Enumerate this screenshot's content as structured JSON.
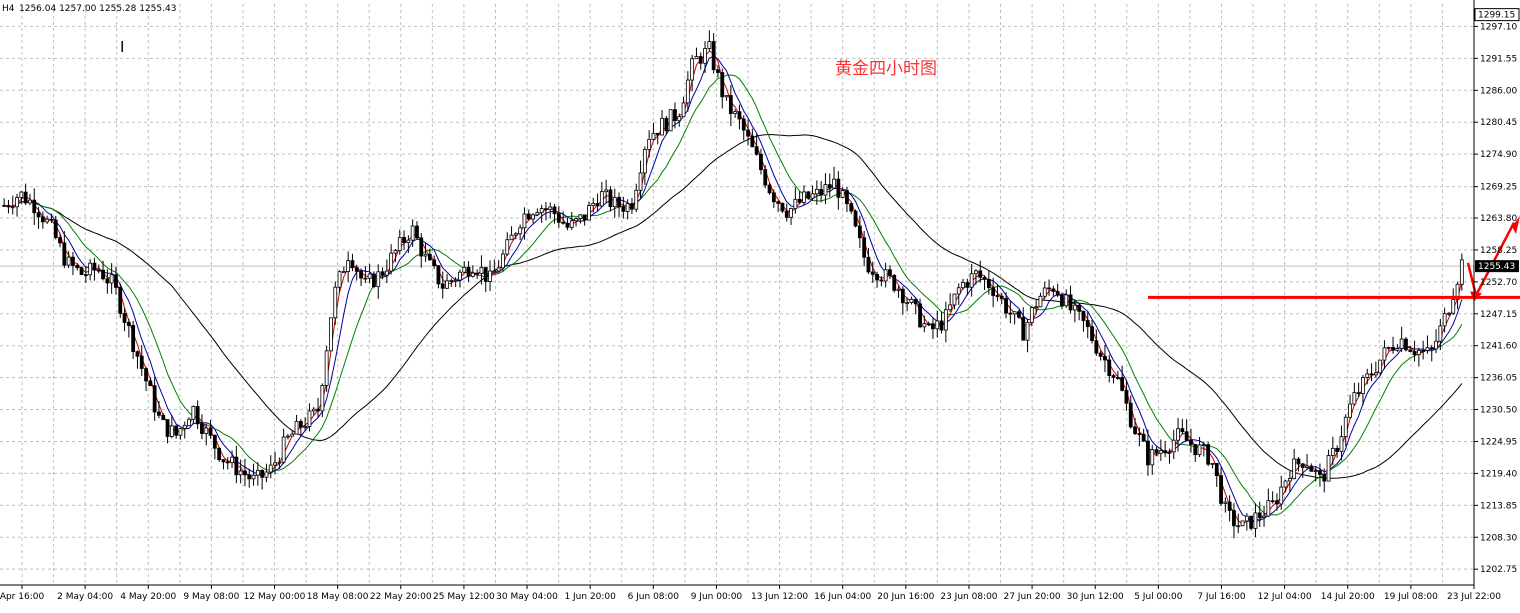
{
  "header": {
    "symbol_tf": "H4",
    "ohlc": "1256.04 1257.00 1255.28 1255.43",
    "marker": "I"
  },
  "chart_data": {
    "type": "candlestick",
    "title": "黄金四小时图",
    "timeframe": "H4",
    "ylim": [
      1200.0,
      1301.0
    ],
    "current_price": 1255.43,
    "top_price": 1299.15,
    "y_ticks": [
      "1297.10",
      "1291.55",
      "1286.00",
      "1280.45",
      "1274.90",
      "1269.25",
      "1263.80",
      "1258.25",
      "1252.70",
      "1247.15",
      "1241.60",
      "1236.05",
      "1230.50",
      "1224.95",
      "1219.40",
      "1213.85",
      "1208.30",
      "1202.75"
    ],
    "x_ticks": [
      "Apr 16:00",
      "2 May 04:00",
      "4 May 20:00",
      "9 May 08:00",
      "12 May 00:00",
      "18 May 08:00",
      "22 May 20:00",
      "25 May 12:00",
      "30 May 04:00",
      "1 Jun 20:00",
      "6 Jun 08:00",
      "9 Jun 00:00",
      "13 Jun 12:00",
      "16 Jun 04:00",
      "20 Jun 16:00",
      "23 Jun 08:00",
      "27 Jun 20:00",
      "30 Jun 12:00",
      "5 Jul 00:00",
      "7 Jul 16:00",
      "12 Jul 04:00",
      "14 Jul 20:00",
      "19 Jul 08:00",
      "23 Jul 22:00"
    ],
    "price_anchors": [
      1266,
      1268,
      1266,
      1262,
      1256,
      1254,
      1255,
      1252,
      1244,
      1236,
      1228,
      1226,
      1231,
      1226,
      1222,
      1220,
      1218,
      1220,
      1225,
      1228,
      1230,
      1250,
      1258,
      1252,
      1254,
      1258,
      1262,
      1256,
      1252,
      1254,
      1256,
      1253,
      1258,
      1264,
      1266,
      1265,
      1262,
      1264,
      1268,
      1266,
      1266,
      1278,
      1280,
      1282,
      1291,
      1293,
      1284,
      1280,
      1274,
      1268,
      1265,
      1267,
      1268,
      1270,
      1264,
      1256,
      1254,
      1252,
      1248,
      1244,
      1246,
      1252,
      1254,
      1252,
      1248,
      1244,
      1250,
      1252,
      1248,
      1245,
      1240,
      1236,
      1228,
      1222,
      1224,
      1226,
      1224,
      1222,
      1212,
      1210,
      1212,
      1214,
      1220,
      1222,
      1218,
      1224,
      1232,
      1236,
      1240,
      1243,
      1241,
      1240,
      1247,
      1256
    ],
    "horizontal_level": 1250.0,
    "colors": {
      "candle": "#000000",
      "ma_fast": "#d20000",
      "ma_mid": "#0000a0",
      "ma_slow": "#008000",
      "ma_long": "#000000",
      "level_line": "#ff0000",
      "title_color": "#ff3030",
      "grid": "#c0c0c0",
      "price_tag_bg": "#000000",
      "price_tag_fg": "#ffffff"
    },
    "grid": true,
    "annotations": [
      "horizontal red support line near 1250",
      "red arrows indicating pullback then upward move"
    ]
  }
}
